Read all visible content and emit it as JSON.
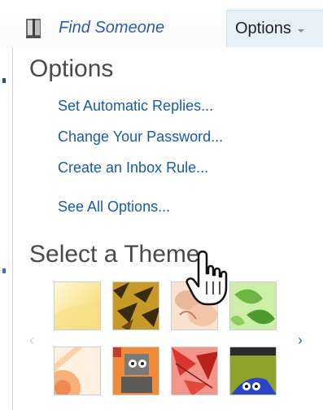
{
  "topbar": {
    "find_someone": "Find Someone",
    "options_tab": "Options"
  },
  "options_panel": {
    "title": "Options",
    "links": [
      "Set Automatic Replies...",
      "Change Your Password...",
      "Create an Inbox Rule...",
      "See All Options..."
    ]
  },
  "theme_section": {
    "title": "Select a Theme",
    "prev_arrow": "‹",
    "next_arrow": "›",
    "themes": [
      {
        "name": "sunshine-theme",
        "colors": [
          "#fff6c8",
          "#f8d968"
        ]
      },
      {
        "name": "tiger-theme",
        "colors": [
          "#b88a1c",
          "#3a2a10"
        ]
      },
      {
        "name": "flower-theme",
        "colors": [
          "#f6d7c1",
          "#e6a184"
        ]
      },
      {
        "name": "leaves-theme",
        "colors": [
          "#b8e38e",
          "#5fa63a"
        ]
      },
      {
        "name": "sunset-theme",
        "colors": [
          "#fde3c8",
          "#f39a6a"
        ]
      },
      {
        "name": "robot-theme",
        "colors": [
          "#f07f2a",
          "#5a5a5a"
        ]
      },
      {
        "name": "autumn-theme",
        "colors": [
          "#f07a70",
          "#b5231c"
        ]
      },
      {
        "name": "monster-theme",
        "colors": [
          "#8a9c28",
          "#2a40c8"
        ]
      }
    ]
  }
}
